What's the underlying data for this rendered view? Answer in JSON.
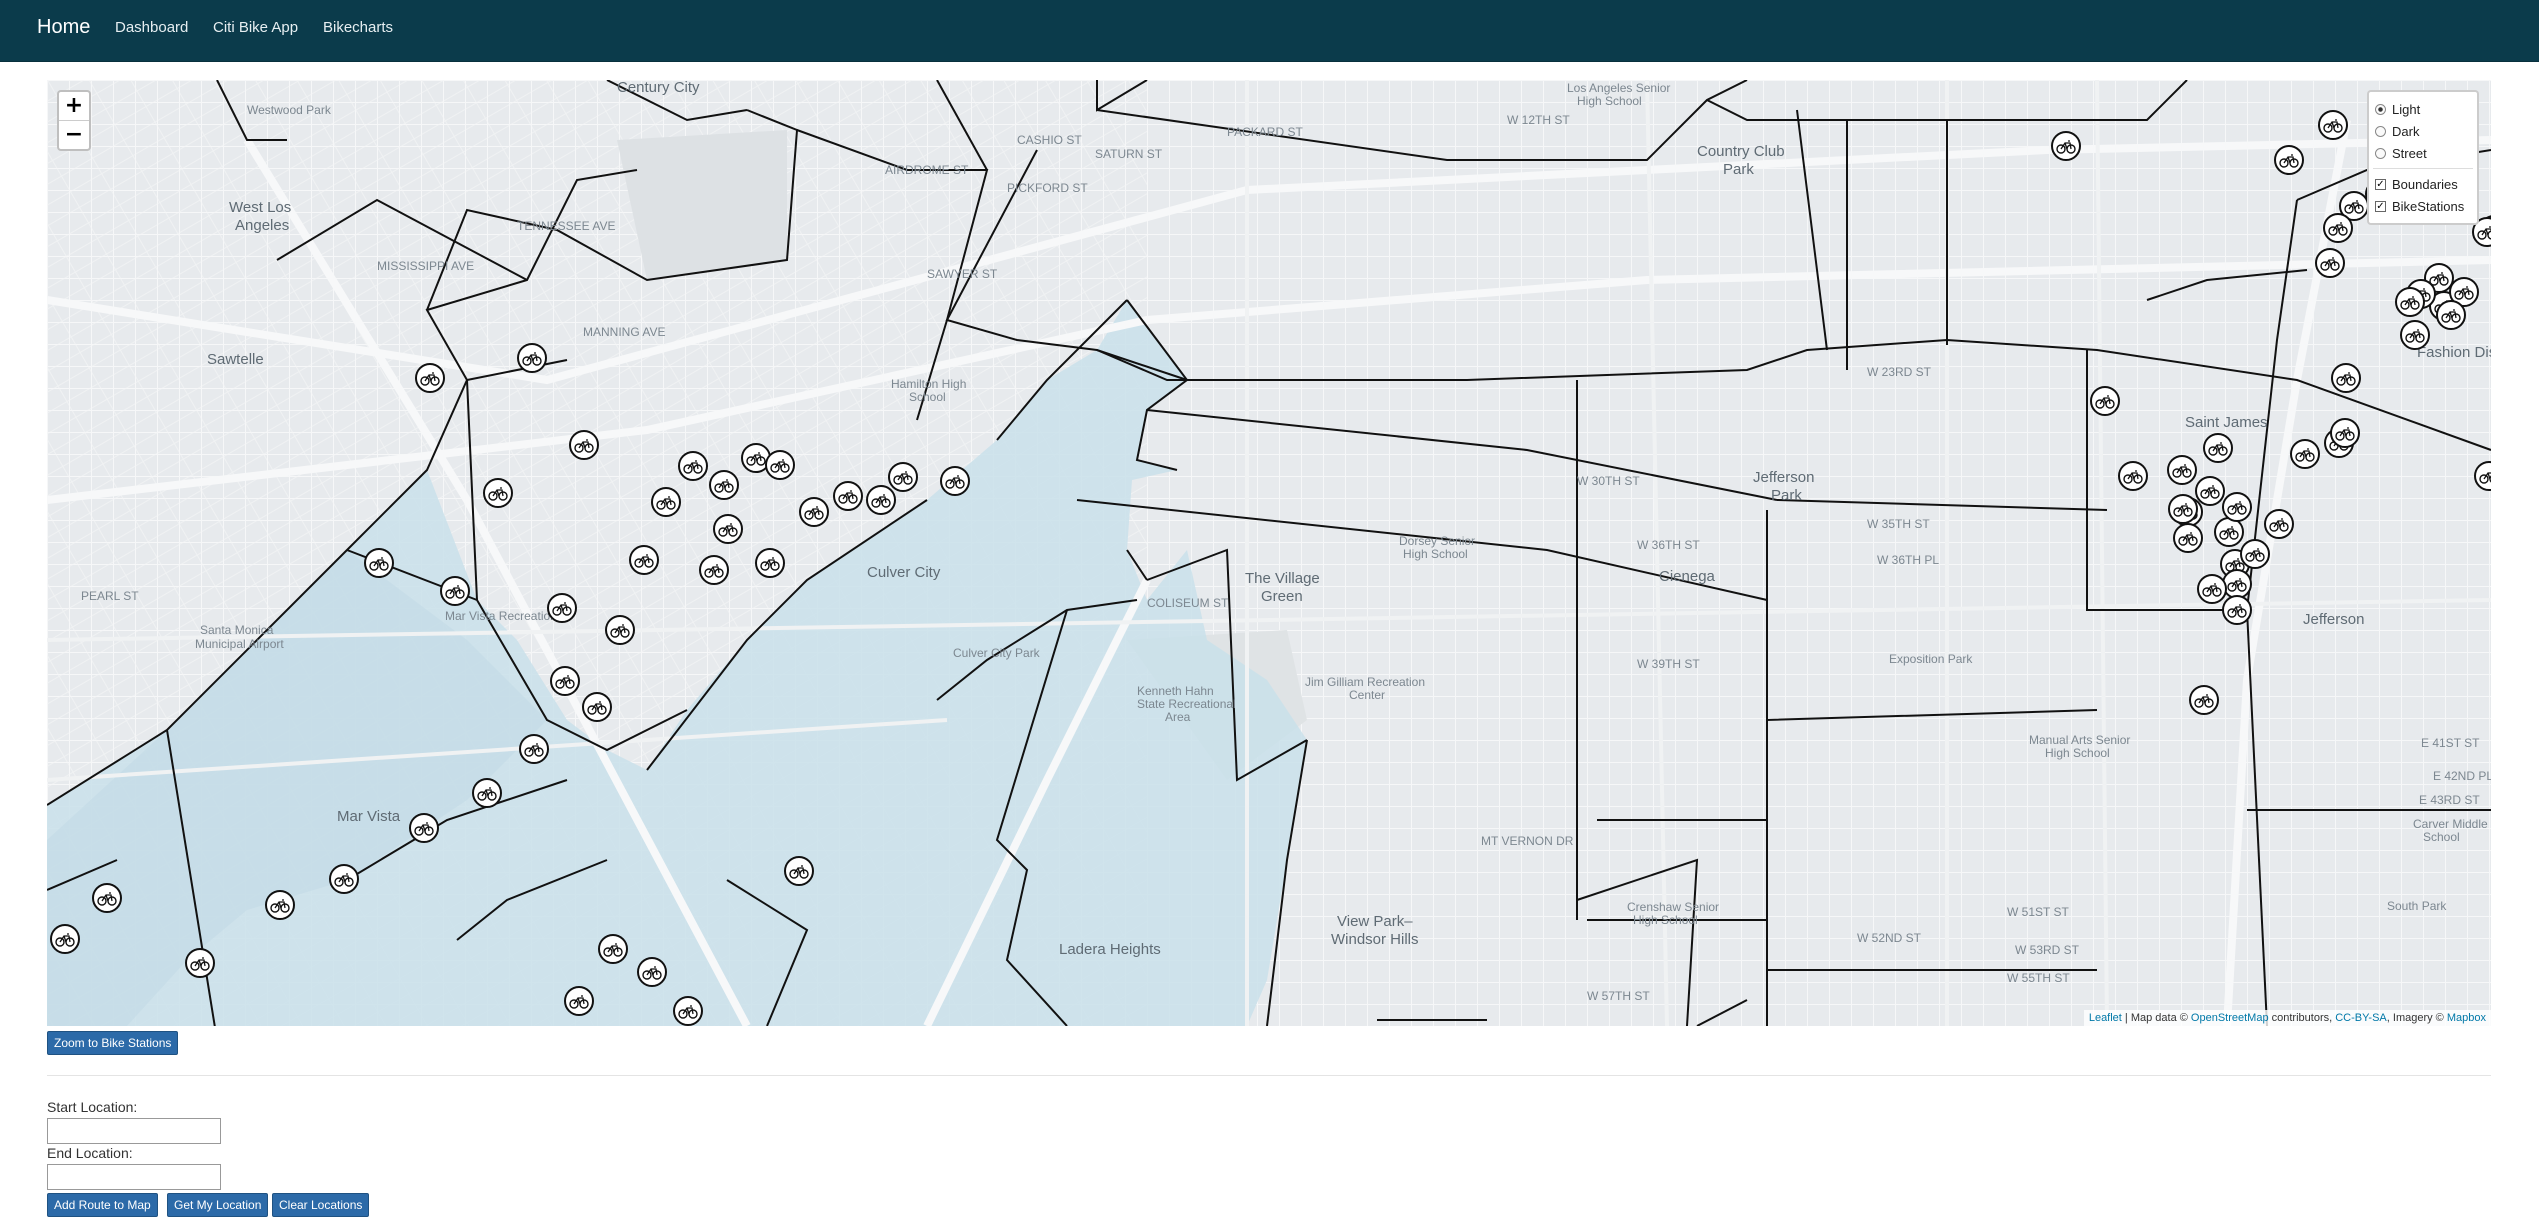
{
  "nav": {
    "brand": "Home",
    "links": [
      "Dashboard",
      "Citi Bike App",
      "Bikecharts"
    ]
  },
  "map": {
    "zoom_in": "+",
    "zoom_out": "−",
    "layers": {
      "base": [
        {
          "label": "Light",
          "selected": true
        },
        {
          "label": "Dark",
          "selected": false
        },
        {
          "label": "Street",
          "selected": false
        }
      ],
      "overlays": [
        {
          "label": "Boundaries",
          "checked": true
        },
        {
          "label": "BikeStations",
          "checked": true
        }
      ]
    },
    "attribution": {
      "leaflet": "Leaflet",
      "text1": " | Map data © ",
      "osm": "OpenStreetMap",
      "text2": " contributors, ",
      "license": "CC-BY-SA",
      "text3": ", Imagery © ",
      "mapbox": "Mapbox"
    },
    "place_labels": {
      "century_city": "Century City",
      "west_la": "West Los\nAngeles",
      "sawtelle": "Sawtelle",
      "country_club_park": "Country Club\nPark",
      "saint_james": "Saint James",
      "fashion": "Fashion Dis",
      "jefferson_park": "Jefferson\nPark",
      "cienega": "Cienega",
      "village_green": "The Village\nGreen",
      "culver_city": "Culver City",
      "mar_vista": "Mar Vista",
      "ladera": "Ladera Heights",
      "view_park": "View Park–\nWindsor Hills",
      "jefferson": "Jefferson",
      "exposition_park": "Exposition Park",
      "santa_monica_airport": "Santa Monica\nMunicipal Airport",
      "dorsey": "Dorsey Senior\nHigh School",
      "jim_gilliam": "Jim Gilliam Recreation\nCenter",
      "manual_arts": "Manual Arts Senior\nHigh School",
      "crenshaw": "Crenshaw Senior\nHigh School",
      "carver": "Carver Middle\nSchool",
      "south_park": "South Park",
      "la_senior": "Los Angeles Senior\nHigh School",
      "hamilton": "Hamilton High\nSchool",
      "kenneth_hahn": "Kenneth Hahn\nState Recreational\nArea",
      "culver_city_park": "Culver City Park",
      "mar_vista_rec": "Mar Vista Recreation",
      "westwood_park": "Westwood Park"
    },
    "street_labels": [
      "W 23RD ST",
      "W 30TH ST",
      "W 36TH ST",
      "W 39TH ST",
      "W 35TH ST",
      "W 36TH PL",
      "COLISEUM ST",
      "MT VERNON DR",
      "E 41ST ST",
      "E 42ND PL",
      "E 43RD ST",
      "W 51ST ST",
      "W 52ND ST",
      "W 53RD ST",
      "W 55TH ST",
      "W 57TH ST",
      "SAWYER ST",
      "SATURN ST",
      "PICKFORD ST",
      "CASHIO ST",
      "W 12TH ST",
      "PACKARD ST",
      "AIRDROME ST",
      "MANNING AVE",
      "TENNESSEE AVE",
      "MISSISSIPPI AVE",
      "PEARL ST"
    ]
  },
  "buttons": {
    "zoom_stations": "Zoom to Bike Stations",
    "add_route": "Add Route to Map",
    "my_location": "Get My Location",
    "clear": "Clear Locations"
  },
  "form": {
    "start_label": "Start Location:",
    "end_label": "End Location:",
    "start_value": "",
    "end_value": ""
  },
  "colors": {
    "navbar": "#0b3b4b",
    "map_base": "#e7eaed",
    "highlight_region": "#c9e0ea",
    "button": "#2c6aa8"
  }
}
